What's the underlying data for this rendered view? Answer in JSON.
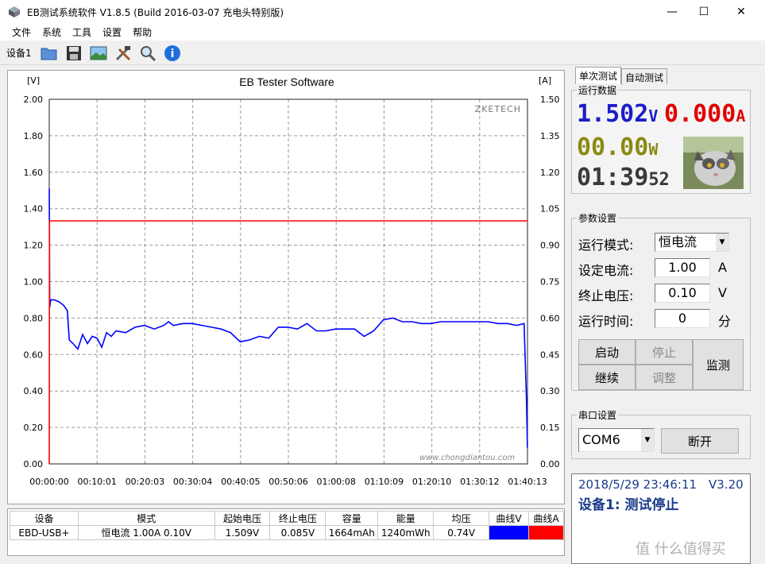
{
  "window": {
    "title": "EB测试系统软件 V1.8.5 (Build 2016-03-07 充电头特别版)",
    "minimize": "—",
    "maximize": "☐",
    "close": "✕"
  },
  "menu": [
    "文件",
    "系统",
    "工具",
    "设置",
    "帮助"
  ],
  "toolbar": {
    "device_label": "设备1"
  },
  "chart": {
    "title": "EB Tester Software",
    "left_unit": "[V]",
    "right_unit": "[A]",
    "watermark": "ZKETECH",
    "site_watermark": "www.chongdiantou.com"
  },
  "chart_data": {
    "type": "line",
    "title": "EB Tester Software",
    "xlabel": "",
    "ylabel": "[V]",
    "y2label": "[A]",
    "ylim": [
      0,
      2.0
    ],
    "y2lim": [
      0,
      1.5
    ],
    "y_ticks": [
      "2.00",
      "1.80",
      "1.60",
      "1.40",
      "1.20",
      "1.00",
      "0.80",
      "0.60",
      "0.40",
      "0.20",
      "0.00"
    ],
    "y2_ticks": [
      "1.50",
      "1.35",
      "1.20",
      "1.05",
      "0.90",
      "0.75",
      "0.60",
      "0.45",
      "0.30",
      "0.15",
      "0.00"
    ],
    "x_ticks": [
      "00:00:00",
      "00:10:01",
      "00:20:03",
      "00:30:04",
      "00:40:05",
      "00:50:06",
      "01:00:08",
      "01:10:09",
      "01:20:10",
      "01:30:12",
      "01:40:13"
    ],
    "grid": true,
    "series": [
      {
        "name": "曲线V",
        "color": "#0000ff",
        "axis": "left",
        "x_minutes": [
          0,
          0.1,
          0.3,
          1,
          2,
          3,
          3.8,
          4.2,
          5,
          6,
          7,
          8,
          9,
          10,
          11,
          12,
          13,
          14,
          16,
          18,
          20,
          22,
          24,
          25,
          26,
          28,
          30,
          32,
          34,
          36,
          38,
          40,
          42,
          44,
          46,
          48,
          50,
          52,
          54,
          56,
          58,
          60,
          62,
          64,
          66,
          68,
          70,
          72,
          74,
          76,
          78,
          80,
          82,
          84,
          86,
          88,
          90,
          92,
          94,
          96,
          98,
          99.5,
          100,
          100.2
        ],
        "values": [
          1.51,
          0.86,
          0.9,
          0.9,
          0.89,
          0.87,
          0.84,
          0.68,
          0.66,
          0.63,
          0.71,
          0.66,
          0.7,
          0.69,
          0.64,
          0.72,
          0.7,
          0.73,
          0.72,
          0.75,
          0.76,
          0.74,
          0.76,
          0.78,
          0.76,
          0.77,
          0.77,
          0.76,
          0.75,
          0.74,
          0.72,
          0.67,
          0.68,
          0.7,
          0.69,
          0.75,
          0.75,
          0.74,
          0.77,
          0.73,
          0.73,
          0.74,
          0.74,
          0.74,
          0.7,
          0.73,
          0.79,
          0.8,
          0.78,
          0.78,
          0.77,
          0.77,
          0.78,
          0.78,
          0.78,
          0.78,
          0.78,
          0.78,
          0.77,
          0.77,
          0.76,
          0.77,
          0.36,
          0.09
        ]
      },
      {
        "name": "曲线A",
        "color": "#ff0000",
        "axis": "right",
        "x_minutes": [
          0,
          0.05,
          0.1,
          100.2
        ],
        "values": [
          0.0,
          1.0,
          1.0,
          1.0
        ]
      }
    ],
    "x_range_minutes": [
      0,
      100.22
    ]
  },
  "stats_table": {
    "headers": [
      "设备",
      "模式",
      "起始电压",
      "终止电压",
      "容量",
      "能量",
      "均压",
      "曲线V",
      "曲线A"
    ],
    "row": [
      "EBD-USB+",
      "恒电流  1.00A  0.10V",
      "1.509V",
      "0.085V",
      "1664mAh",
      "1240mWh",
      "0.74V"
    ],
    "curve_v_color": "#0000ff",
    "curve_a_color": "#ff0000"
  },
  "tabs": [
    "单次测试",
    "自动测试"
  ],
  "run_data": {
    "label": "运行数据",
    "voltage": "1.502",
    "voltage_unit": "V",
    "current": "0.000",
    "current_unit": "A",
    "power": "00.00",
    "power_unit": "W",
    "time": "01:39",
    "seconds": "52",
    "voltage_color": "#1c1cc8",
    "current_color": "#e00000",
    "power_color": "#8a8a14"
  },
  "params": {
    "label": "参数设置",
    "mode_label": "运行模式:",
    "mode_value": "恒电流",
    "current_label": "设定电流:",
    "current_value": "1.00",
    "current_unit": "A",
    "cutoff_label": "终止电压:",
    "cutoff_value": "0.10",
    "cutoff_unit": "V",
    "runtime_label": "运行时间:",
    "runtime_value": "0",
    "runtime_unit": "分",
    "start": "启动",
    "stop": "停止",
    "continue": "继续",
    "adjust": "调整",
    "monitor": "监测"
  },
  "serial": {
    "label": "串口设置",
    "port": "COM6",
    "disconnect": "断开"
  },
  "status": {
    "datetime": "2018/5/29 23:46:11",
    "version": "V3.20",
    "message": "设备1: 测试停止"
  },
  "brand_watermark": "值 什么值得买"
}
